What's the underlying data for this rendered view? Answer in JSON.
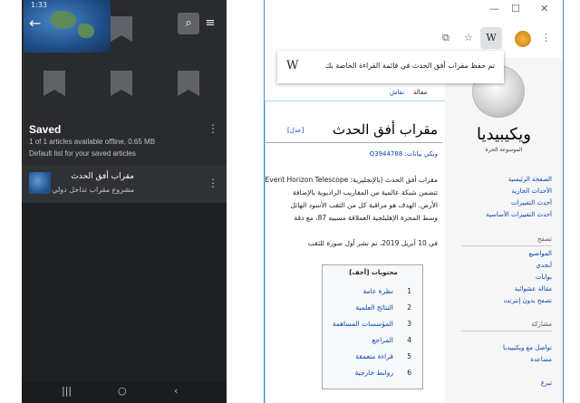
{
  "phone": {
    "status_time": "1:33",
    "back_icon": "arrow-left-icon",
    "search_icon": "search-icon",
    "sort_icon": "sort-icon",
    "saved_title": "Saved",
    "saved_sub": "1 of 1 articles available offline, 0.65 MB",
    "saved_desc": "Default list for your saved articles",
    "article_title": "مقراب أفق الحدث",
    "article_sub": "مشروع مقراب تداخل دولي",
    "nav": {
      "recent": "|||",
      "home": "○",
      "back": "‹"
    }
  },
  "browser": {
    "window": {
      "minimize": "—",
      "maximize": "☐",
      "close": "✕"
    },
    "toolbar": {
      "w_label": "W",
      "kebab": "⋮",
      "star": "☆",
      "translate": "⧉"
    },
    "popup": {
      "icon": "W",
      "text": "تم حفظ مقراب أفق الحدث في قائمة القراءة الخاصة بك"
    },
    "wiki": {
      "site_name": "ويكيبيديا",
      "tagline": "الموسوعة الحرة",
      "nav_links": [
        "الصفحة الرئيسية",
        "الأحداث الجارية",
        "أحدث التغييرات",
        "أحدث التغييرات الأساسية"
      ],
      "heading_tasafuh": "تصفح",
      "browse_links": [
        "المواضيع",
        "أبجدي",
        "بوابات",
        "مقالة عشوائية",
        "تصفح بدون إنترنت"
      ],
      "heading_musharaka": "مشاركة",
      "share_links": [
        "تواصل مع ويكيبيديا",
        "مساعدة",
        "تبرع"
      ],
      "tabs": {
        "article": "مقالة",
        "talk": "نقاش"
      },
      "page_title": "مقراب أفق الحدث",
      "edit": "[عدل]",
      "wikidata": "ويكي بيانات: Q3944788",
      "body": [
        "مقراب أفق الحدث (بالإنجليزية: Event Horizon Telescope",
        "تتضمن شبكة عالمية من المقاريب الراديوية بالإضافة",
        "الأرض. الهدف هو مراقبة كل من الثقب الأسود الهائل",
        "وسط المجرة الإهليلجية العملاقة مسييه 87، مع دقة",
        "في 10 أبريل 2019، تم نشر أول صورة للثقب"
      ],
      "toc": {
        "title": "محتويات [أخف]",
        "items": [
          {
            "num": "1",
            "label": "نظرة عامة"
          },
          {
            "num": "2",
            "label": "النتائج العلمية"
          },
          {
            "num": "3",
            "label": "المؤسسات المساهمة"
          },
          {
            "num": "4",
            "label": "المراجع"
          },
          {
            "num": "5",
            "label": "قراءة متعمقة"
          },
          {
            "num": "6",
            "label": "روابط خارجية"
          }
        ]
      }
    }
  }
}
